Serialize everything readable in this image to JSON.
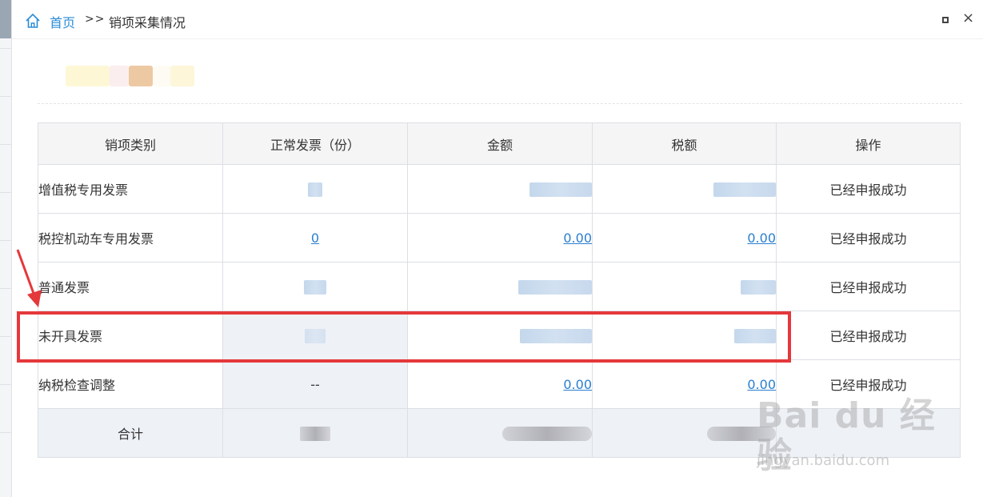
{
  "breadcrumb": {
    "home": "首页",
    "separator": ">>",
    "current": "销项采集情况"
  },
  "window": {
    "maximize_icon": "maximize-icon",
    "close": "×"
  },
  "table": {
    "headers": [
      "销项类别",
      "正常发票（份）",
      "金额",
      "税额",
      "操作"
    ],
    "rows": [
      {
        "category": "增值税专用发票",
        "count": "",
        "amount": "",
        "tax": "",
        "status": "已经申报成功"
      },
      {
        "category": "税控机动车专用发票",
        "count": "0",
        "amount": "0.00",
        "tax": "0.00",
        "status": "已经申报成功"
      },
      {
        "category": "普通发票",
        "count": "",
        "amount": "",
        "tax": "",
        "status": "已经申报成功"
      },
      {
        "category": "未开具发票",
        "count": "",
        "amount": "",
        "tax": "",
        "status": "已经申报成功"
      },
      {
        "category": "纳税检查调整",
        "count": "--",
        "amount": "0.00",
        "tax": "0.00",
        "status": "已经申报成功"
      }
    ],
    "total": {
      "label": "合计",
      "count": "",
      "amount": "",
      "tax": ""
    }
  },
  "watermark": {
    "logo": "Bai du 经验",
    "url": "jingyan.baidu.com"
  },
  "colors": {
    "link": "#2a7fd0",
    "highlight": "#e5383b",
    "header_bg": "#f5f5f5",
    "shade_bg": "#eef1f6"
  }
}
